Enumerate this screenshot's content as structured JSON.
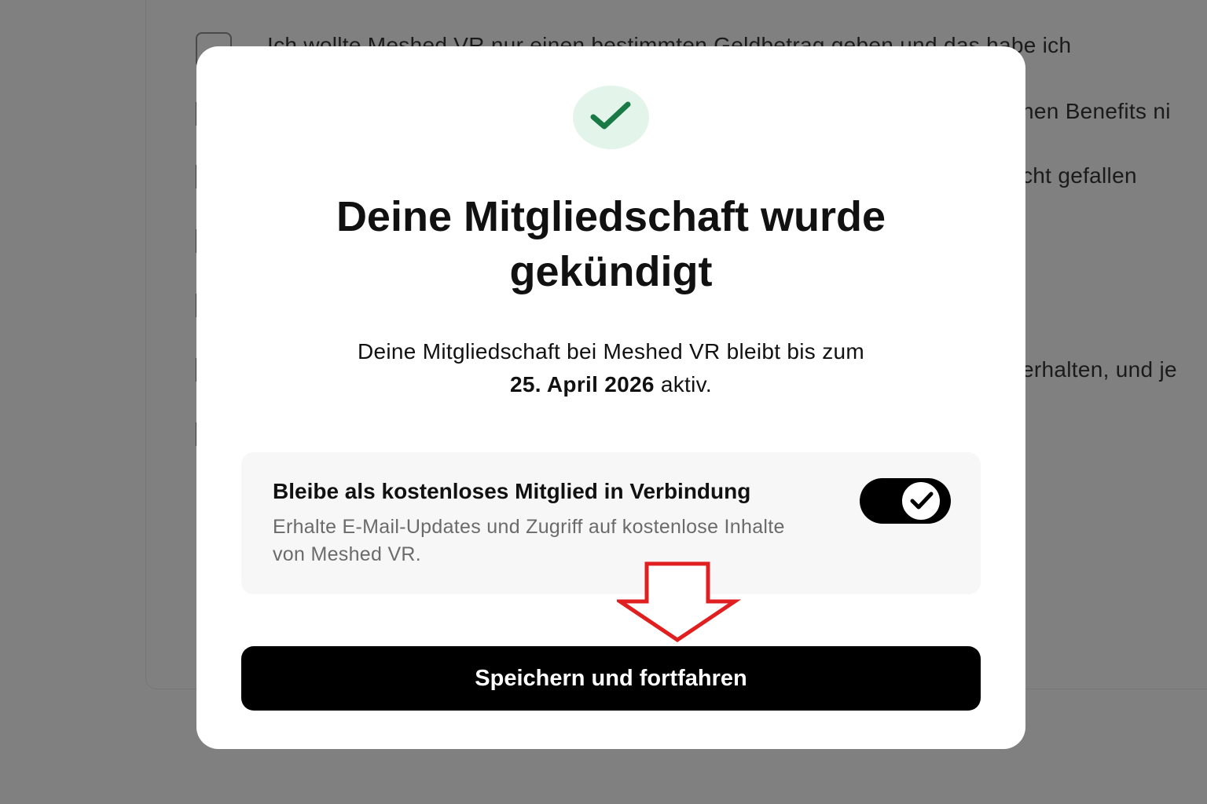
{
  "background": {
    "options": [
      "Ich wollte Meshed VR nur einen bestimmten Geldbetrag geben und das habe ich",
      "nen Benefits ni",
      "cht gefallen",
      "erhalten, und je"
    ]
  },
  "modal": {
    "success_icon": "checkmark-icon",
    "title": "Deine Mitgliedschaft wurde gekündigt",
    "description_prefix": "Deine Mitgliedschaft bei Meshed VR bleibt bis zum",
    "end_date": "25. April 2026",
    "description_suffix": "aktiv.",
    "free_member": {
      "title": "Bleibe als kostenloses Mitglied in Verbindung",
      "subtitle": "Erhalte E-Mail-Updates und Zugriff auf kostenlose Inhalte von Meshed VR.",
      "toggle_on": true
    },
    "save_button": "Speichern und fortfahren"
  },
  "colors": {
    "success_green": "#1a7a45",
    "success_bg": "#e3f5ea",
    "annotation_arrow": "#e02020",
    "button_bg": "#000000"
  }
}
